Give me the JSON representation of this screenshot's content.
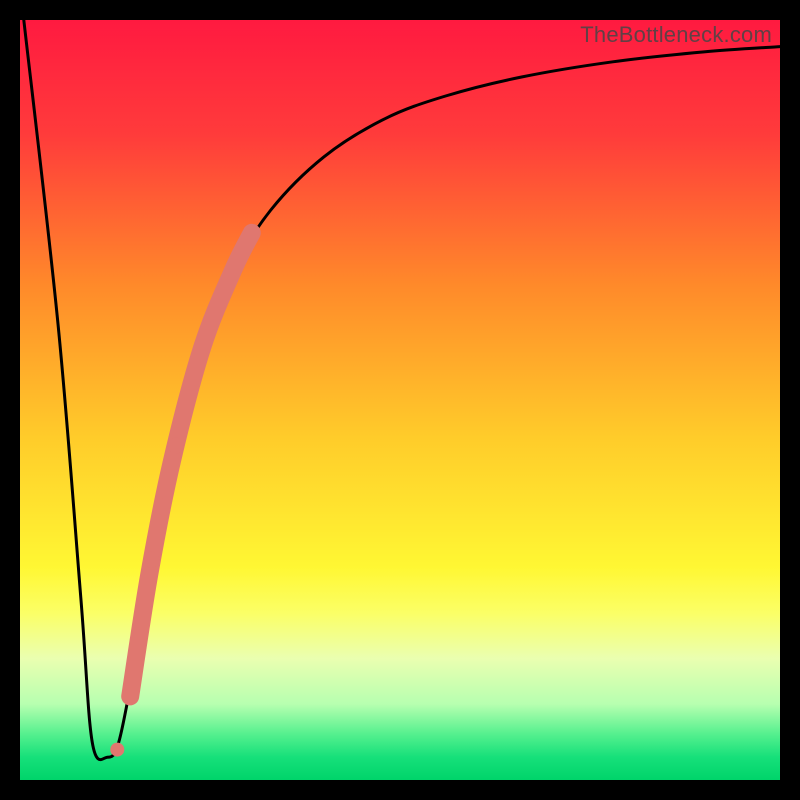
{
  "watermark": "TheBottleneck.com",
  "chart_data": {
    "type": "line",
    "title": "",
    "xlabel": "",
    "ylabel": "",
    "xlim": [
      0,
      100
    ],
    "ylim": [
      0,
      100
    ],
    "gradient_stops": [
      {
        "offset": 0.0,
        "color": "#ff1a40"
      },
      {
        "offset": 0.15,
        "color": "#ff3b3b"
      },
      {
        "offset": 0.35,
        "color": "#ff8a2a"
      },
      {
        "offset": 0.55,
        "color": "#ffcc2a"
      },
      {
        "offset": 0.72,
        "color": "#fff733"
      },
      {
        "offset": 0.78,
        "color": "#fbff66"
      },
      {
        "offset": 0.84,
        "color": "#eaffb0"
      },
      {
        "offset": 0.9,
        "color": "#b7ffb0"
      },
      {
        "offset": 0.94,
        "color": "#54f08e"
      },
      {
        "offset": 0.97,
        "color": "#16e07a"
      },
      {
        "offset": 1.0,
        "color": "#00d46a"
      }
    ],
    "series": [
      {
        "name": "curve",
        "x": [
          0.5,
          5,
          8,
          9.5,
          11.5,
          13,
          15,
          17,
          20,
          24,
          28,
          33,
          40,
          48,
          56,
          66,
          78,
          90,
          100
        ],
        "y": [
          100,
          60,
          24,
          5,
          3,
          5,
          15,
          27,
          42,
          57,
          67,
          75,
          82,
          87,
          90,
          92.5,
          94.5,
          95.8,
          96.5
        ]
      }
    ],
    "marker_band": {
      "name": "highlighted-segment",
      "color": "#e0776f",
      "x": [
        14.5,
        17,
        20,
        24,
        28,
        30.5
      ],
      "y": [
        11,
        27,
        42,
        57,
        67,
        72
      ]
    },
    "markers": [
      {
        "x": 12.8,
        "y": 4,
        "r": 7
      },
      {
        "x": 17.3,
        "y": 29,
        "r": 8
      },
      {
        "x": 18.7,
        "y": 36,
        "r": 8
      },
      {
        "x": 20.5,
        "y": 44,
        "r": 8
      }
    ]
  }
}
